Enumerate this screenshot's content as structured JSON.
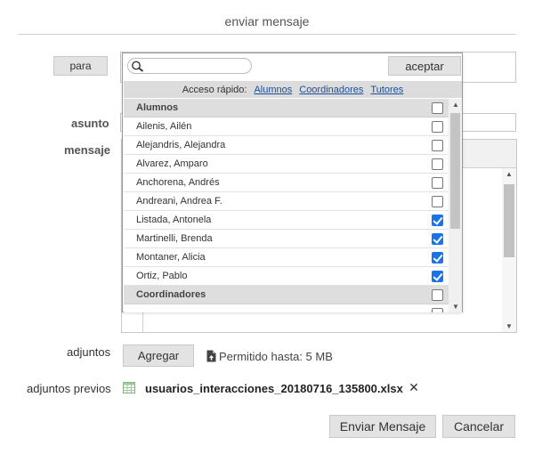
{
  "title": "enviar mensaje",
  "form": {
    "para_label": "para",
    "asunto_label": "asunto",
    "mensaje_label": "mensaje"
  },
  "recipients_popup": {
    "search_placeholder": "",
    "aceptar_label": "aceptar",
    "quick_access_label": "Acceso rápido:",
    "quick_links": [
      "Alumnos",
      "Coordinadores",
      "Tutores"
    ],
    "groups": [
      {
        "name": "Alumnos",
        "checked": false,
        "items": [
          {
            "name": "Ailenis, Ailén",
            "checked": false
          },
          {
            "name": "Alejandris, Alejandra",
            "checked": false
          },
          {
            "name": "Alvarez, Amparo",
            "checked": false
          },
          {
            "name": "Anchorena, Andrés",
            "checked": false
          },
          {
            "name": "Andreani, Andrea F.",
            "checked": false
          },
          {
            "name": "Listada, Antonela",
            "checked": true
          },
          {
            "name": "Martinelli, Brenda",
            "checked": true
          },
          {
            "name": "Montaner, Alicia",
            "checked": true
          },
          {
            "name": "Ortiz, Pablo",
            "checked": true
          }
        ]
      },
      {
        "name": "Coordinadores",
        "checked": false,
        "items": []
      }
    ]
  },
  "attachments": {
    "label": "adjuntos",
    "add_button": "Agregar",
    "limit_text": "Permitido hasta: 5 MB",
    "previous_label": "adjuntos previos",
    "previous_file": "usuarios_interacciones_20180716_135800.xlsx"
  },
  "actions": {
    "send": "Enviar Mensaje",
    "cancel": "Cancelar"
  },
  "colors": {
    "checkbox_checked": "#1a73e8",
    "link": "#1a4fa6",
    "group_header_bg": "#dedede"
  }
}
